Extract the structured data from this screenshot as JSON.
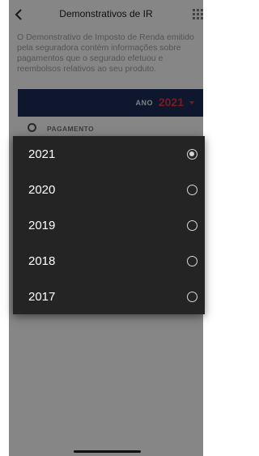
{
  "header": {
    "title": "Demonstrativos de IR",
    "back_icon": "chevron-left-icon",
    "grid_icon": "grid-icon"
  },
  "intro": {
    "text": "O Demonstrativo de Imposto de Renda emitido pela seguradora contém informações sobre pagamentos que o segurado efetuou e reembolsos relativos ao seu produto."
  },
  "year_selector": {
    "label": "ANO",
    "value": "2021",
    "value_color": "#e0323a",
    "bar_color": "#1a2a52"
  },
  "options": {
    "payment_label": "PAGAMENTO"
  },
  "year_menu": {
    "options": [
      {
        "label": "2021",
        "selected": true
      },
      {
        "label": "2020",
        "selected": false
      },
      {
        "label": "2019",
        "selected": false
      },
      {
        "label": "2018",
        "selected": false
      },
      {
        "label": "2017",
        "selected": false
      }
    ]
  },
  "colors": {
    "accent_orange": "#e07a2c",
    "menu_background": "#242424"
  }
}
